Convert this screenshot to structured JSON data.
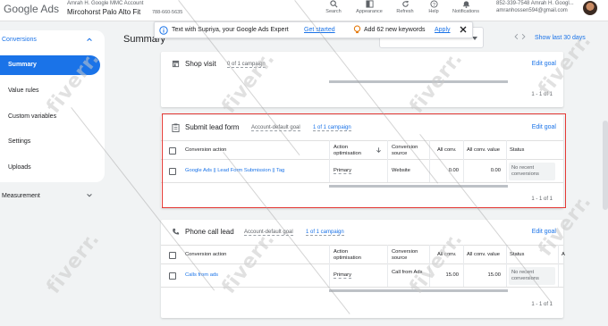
{
  "header": {
    "logo": "Google Ads",
    "manager_account": "Amrah H. Google MMC Account",
    "account_name": "Mircohorst Palo Alto Fit",
    "account_id": "788-660-5635",
    "tools": [
      {
        "label": "Search",
        "icon": "search-icon"
      },
      {
        "label": "Appearance",
        "icon": "appearance-icon"
      },
      {
        "label": "Refresh",
        "icon": "refresh-icon"
      },
      {
        "label": "Help",
        "icon": "help-icon"
      },
      {
        "label": "Notifications",
        "icon": "bell-icon"
      }
    ],
    "user_line1": "852-339-7548 Amrah H. Googl...",
    "user_line2": "amranhossen594@gmail.com"
  },
  "sidebar": {
    "group_label": "Conversions",
    "items": [
      {
        "label": "Summary",
        "active": true
      },
      {
        "label": "Value rules",
        "active": false
      },
      {
        "label": "Custom variables",
        "active": false
      },
      {
        "label": "Settings",
        "active": false
      },
      {
        "label": "Uploads",
        "active": false
      }
    ],
    "measurement_label": "Measurement"
  },
  "summary": {
    "title": "Summary",
    "period": "Show last 30 days"
  },
  "notification": {
    "text1": "Text with Supriya, your Google Ads Expert",
    "link1": "Get started",
    "text2": "Add 62 new keywords",
    "link2": "Apply"
  },
  "cards": {
    "shop": {
      "title": "Shop visit",
      "meta": "0 of 1 campaign",
      "edit": "Edit goal",
      "pager": "1 - 1 of 1"
    },
    "lead": {
      "title": "Submit lead form",
      "meta": "Account-default goal",
      "meta2": "1 of 1 campaign",
      "edit": "Edit goal",
      "headers": {
        "action": "Conversion action",
        "opt": "Action optimisation",
        "source": "Conversion source",
        "convs": "All conv.",
        "value": "All conv. value",
        "status": "Status"
      },
      "row": {
        "action": "Google Ads || Lead Form Submission || Tag",
        "opt": "Primary",
        "source": "Website",
        "convs": "0.00",
        "value": "0.00",
        "status": "No recent conversions"
      },
      "pager": "1 - 1 of 1"
    },
    "phone": {
      "title": "Phone call lead",
      "meta": "Account-default goal",
      "meta2": "1 of 1 campaign",
      "edit": "Edit goal",
      "headers": {
        "action": "Conversion action",
        "opt": "Action optimisation",
        "source": "Conversion source",
        "convs": "All conv.",
        "value": "All conv. value",
        "status": "Status",
        "extra": "A"
      },
      "row": {
        "action": "Calls from ads",
        "opt": "Primary",
        "source": "Call from Ads",
        "convs": "15.00",
        "value": "15.00",
        "status": "No recent conversions"
      },
      "pager": "1 - 1 of 1"
    }
  },
  "watermark": "fiverr.",
  "colors": {
    "accent": "#1a73e8",
    "highlight": "#e53935",
    "background": "#f1f3f4"
  }
}
